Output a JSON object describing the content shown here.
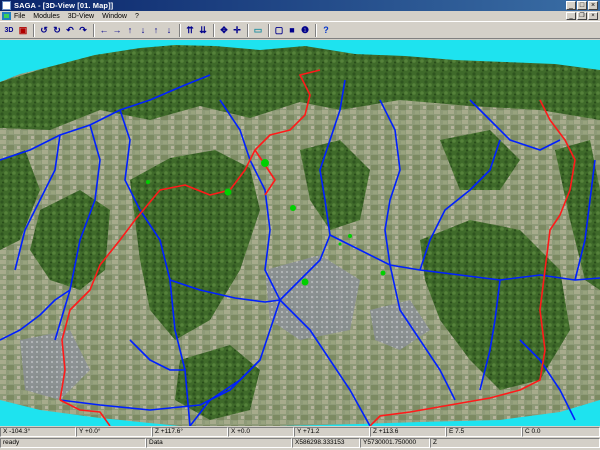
{
  "window": {
    "title": "SAGA - [3D-View [01. Map]]",
    "controls": {
      "minimize": "_",
      "maximize": "□",
      "close": "×"
    }
  },
  "menu": {
    "items": [
      "File",
      "Modules",
      "3D-View",
      "Window",
      "?"
    ],
    "mdi_controls": {
      "minimize": "_",
      "restore": "❐",
      "close": "×"
    }
  },
  "toolbar": {
    "first_label": "3D",
    "buttons": [
      {
        "icon": "3d-view-icon",
        "glyph": "3D",
        "kind": "text"
      },
      {
        "icon": "color-mode-icon",
        "glyph": "▣",
        "kind": "red"
      },
      {
        "kind": "sep"
      },
      {
        "icon": "rotate-left-icon",
        "glyph": "↺"
      },
      {
        "icon": "rotate-right-icon",
        "glyph": "↻"
      },
      {
        "icon": "tilt-up-icon",
        "glyph": "↶"
      },
      {
        "icon": "tilt-down-icon",
        "glyph": "↷"
      },
      {
        "kind": "sep"
      },
      {
        "icon": "arrow-left-icon",
        "glyph": "←"
      },
      {
        "icon": "arrow-right-icon",
        "glyph": "→"
      },
      {
        "icon": "arrow-up-icon",
        "glyph": "↑"
      },
      {
        "icon": "arrow-down-icon",
        "glyph": "↓"
      },
      {
        "icon": "arrow-up-2-icon",
        "glyph": "↑"
      },
      {
        "icon": "arrow-down-2-icon",
        "glyph": "↓"
      },
      {
        "kind": "sep"
      },
      {
        "icon": "exaggerate-up-icon",
        "glyph": "⇈"
      },
      {
        "icon": "exaggerate-down-icon",
        "glyph": "⇊"
      },
      {
        "kind": "sep"
      },
      {
        "icon": "move-icon",
        "glyph": "✥"
      },
      {
        "icon": "center-icon",
        "glyph": "✛"
      },
      {
        "kind": "sep"
      },
      {
        "icon": "open-folder-icon",
        "glyph": "▭",
        "kind": "teal"
      },
      {
        "kind": "sep"
      },
      {
        "icon": "frame-icon",
        "glyph": "▢"
      },
      {
        "icon": "fill-icon",
        "glyph": "■"
      },
      {
        "icon": "info-icon",
        "glyph": "❶"
      },
      {
        "kind": "sep"
      },
      {
        "icon": "help-icon",
        "glyph": "?",
        "kind": "blue"
      }
    ]
  },
  "statusbar": {
    "row1": [
      "X -104.3°",
      "Y +0.0°",
      "Z +117.6°",
      "X +0.0",
      "Y +71.2",
      "Z +113.6",
      "E 7.5",
      "C 0.0"
    ],
    "row2": [
      "ready",
      "Data",
      "X586298.333153",
      "Y5730001.750000",
      "Z"
    ]
  },
  "colors": {
    "sky": "#1ee3ef",
    "title_gradient_start": "#0a246a",
    "title_gradient_end": "#3a6ea5",
    "rivers": "#0020ff",
    "boundary": "#ff1a1a",
    "vegetation": "#00d000"
  }
}
